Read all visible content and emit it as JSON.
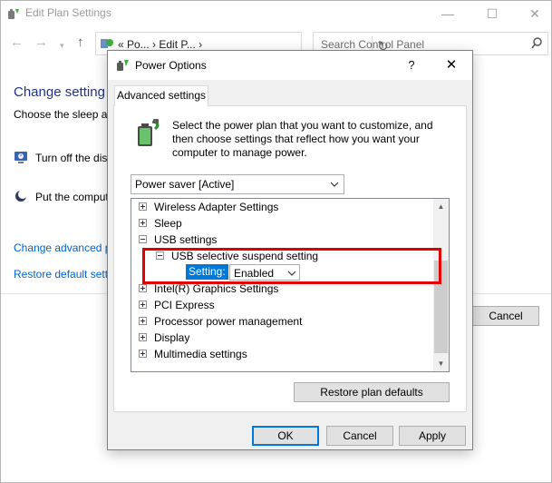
{
  "background_window": {
    "title": "Edit Plan Settings",
    "caption_min": "—",
    "caption_max": "☐",
    "caption_close": "✕",
    "nav_back": "←",
    "nav_forward": "→",
    "nav_dropdown": "▾",
    "nav_up": "↑",
    "address_text": "« Po... › Edit P...  ›",
    "refresh_glyph": "↻",
    "search_placeholder": "Search Control Panel",
    "heading": "Change setting",
    "subtext": "Choose the sleep an",
    "rows": {
      "display_label": "Turn off the dis",
      "sleep_label": "Put the comput"
    },
    "link_advanced": "Change advanced p",
    "link_restore": "Restore default setti",
    "cancel_label": "Cancel"
  },
  "dialog": {
    "title": "Power Options",
    "help_glyph": "?",
    "close_glyph": "✕",
    "tab_label": "Advanced settings",
    "intro_text": "Select the power plan that you want to customize, and then choose settings that reflect how you want your computer to manage power.",
    "plan_selected": "Power saver [Active]",
    "tree": {
      "items": [
        {
          "label": "Wireless Adapter Settings",
          "expanded": false
        },
        {
          "label": "Sleep",
          "expanded": false
        },
        {
          "label": "USB settings",
          "expanded": true
        },
        {
          "label": "USB selective suspend setting",
          "expanded": true,
          "level": 1
        },
        {
          "label": "Intel(R) Graphics Settings",
          "expanded": false
        },
        {
          "label": "PCI Express",
          "expanded": false
        },
        {
          "label": "Processor power management",
          "expanded": false
        },
        {
          "label": "Display",
          "expanded": false
        },
        {
          "label": "Multimedia settings",
          "expanded": false
        }
      ],
      "setting_label": "Setting:",
      "setting_value": "Enabled",
      "scroll_position_fraction": 0.35
    },
    "restore_label": "Restore plan defaults",
    "ok_label": "OK",
    "cancel_label": "Cancel",
    "apply_label": "Apply",
    "colors": {
      "selection": "#0078d7",
      "highlight_border": "#e00000",
      "link": "#0064c8",
      "heading": "#1e3287"
    }
  }
}
